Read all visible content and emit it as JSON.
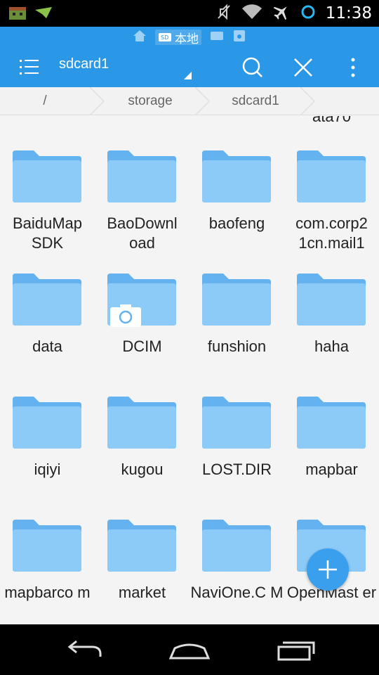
{
  "status_bar": {
    "time": "11:38",
    "icons": [
      "app-icon",
      "notification-icon",
      "mute-icon",
      "wifi-icon",
      "airplane-icon",
      "sync-icon"
    ]
  },
  "app_bar": {
    "mode_label": "本地",
    "title": "sdcard1",
    "color": "#2a98e6"
  },
  "breadcrumb": {
    "items": [
      "/",
      "storage",
      "sdcard1"
    ]
  },
  "files": {
    "partial_label": "ata70",
    "items": [
      {
        "name": "BaiduMap SDK"
      },
      {
        "name": "BaoDownl oad"
      },
      {
        "name": "baofeng"
      },
      {
        "name": "com.corp2 1cn.mail1"
      },
      {
        "name": "data"
      },
      {
        "name": "DCIM"
      },
      {
        "name": "funshion"
      },
      {
        "name": "haha"
      },
      {
        "name": "iqiyi"
      },
      {
        "name": "kugou"
      },
      {
        "name": "LOST.DIR"
      },
      {
        "name": "mapbar"
      },
      {
        "name": "mapbarco m"
      },
      {
        "name": "market"
      },
      {
        "name": "NaviOne.C M"
      },
      {
        "name": "OpenMast er"
      }
    ]
  },
  "nav": {
    "icons": [
      "back-icon",
      "home-icon",
      "recents-icon"
    ]
  }
}
